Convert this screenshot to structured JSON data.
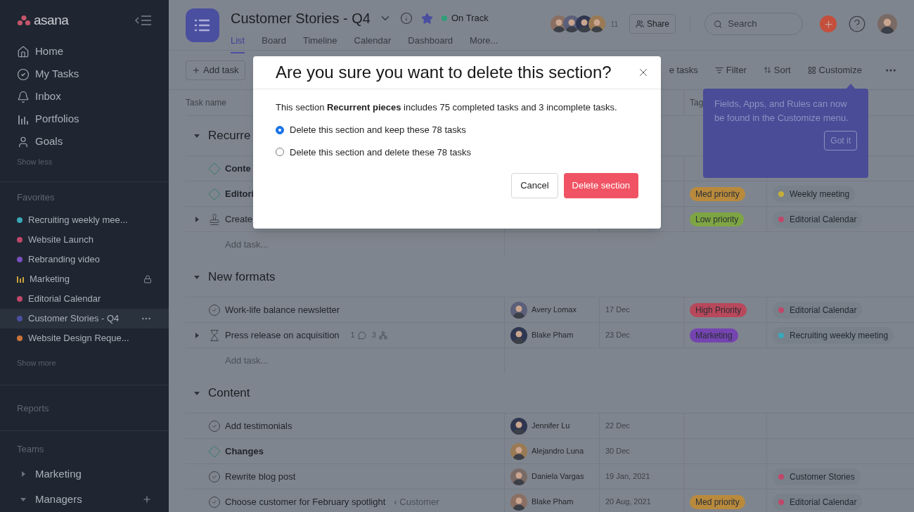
{
  "sidebar": {
    "logo": "asana",
    "nav": [
      {
        "label": "Home"
      },
      {
        "label": "My Tasks"
      },
      {
        "label": "Inbox"
      },
      {
        "label": "Portfolios"
      },
      {
        "label": "Goals"
      }
    ],
    "show_less": "Show less",
    "favorites_title": "Favorites",
    "favorites": [
      {
        "label": "Recruiting weekly mee...",
        "kind": "dot",
        "color": "#3aa8b8",
        "locked": false,
        "selected": false
      },
      {
        "label": "Website Launch",
        "kind": "dot",
        "color": "#c0476a",
        "locked": false,
        "selected": false
      },
      {
        "label": "Rebranding video",
        "kind": "dot",
        "color": "#7a4fc0",
        "locked": false,
        "selected": false
      },
      {
        "label": "Marketing",
        "kind": "chart",
        "color": "#c9a23a",
        "locked": true,
        "selected": false
      },
      {
        "label": "Editorial Calendar",
        "kind": "dot",
        "color": "#c0476a",
        "locked": false,
        "selected": false
      },
      {
        "label": "Customer Stories - Q4",
        "kind": "dot",
        "color": "#4b4fa0",
        "locked": false,
        "selected": true
      },
      {
        "label": "Website Design Reque...",
        "kind": "dot",
        "color": "#c9743a",
        "locked": false,
        "selected": false
      }
    ],
    "show_more": "Show more",
    "reports": "Reports",
    "teams_title": "Teams",
    "teams": [
      {
        "label": "Marketing",
        "expanded": false
      },
      {
        "label": "Managers",
        "expanded": true
      }
    ]
  },
  "header": {
    "title": "Customer Stories - Q4",
    "starred": true,
    "status": {
      "label": "On Track",
      "color": "#2f9e7a"
    },
    "tabs": [
      {
        "label": "List",
        "selected": true
      },
      {
        "label": "Board",
        "selected": false
      },
      {
        "label": "Timeline",
        "selected": false
      },
      {
        "label": "Calendar",
        "selected": false
      },
      {
        "label": "Dashboard",
        "selected": false
      },
      {
        "label": "More...",
        "selected": false
      }
    ],
    "member_count": "11",
    "share": "Share",
    "search": {
      "placeholder": "Search"
    }
  },
  "toolbar": {
    "add_task": "Add task",
    "actions": [
      {
        "label": "e tasks"
      },
      {
        "label": "Filter"
      },
      {
        "label": "Sort"
      },
      {
        "label": "Customize"
      }
    ]
  },
  "table": {
    "columns": [
      {
        "label": "Task name"
      },
      {
        "label": "Tag"
      }
    ],
    "sections": [
      {
        "title": "Recurre",
        "add_task": "Add task...",
        "tasks": [
          {
            "name": "Conte",
            "kind": "milestone",
            "expandable": false
          },
          {
            "name": "Editori",
            "kind": "milestone",
            "expandable": false,
            "priority": {
              "label": "Med priority",
              "color": "#b98a3c"
            },
            "project": {
              "label": "Weekly meeting",
              "color": "#c4ae3a"
            }
          },
          {
            "name": "Create",
            "kind": "approval",
            "expandable": true,
            "priority": {
              "label": "Low priority",
              "color": "#7ea543"
            },
            "project": {
              "label": "Editorial Calendar",
              "color": "#c0476a"
            }
          }
        ]
      },
      {
        "title": "New formats",
        "add_task": "Add task...",
        "tasks": [
          {
            "name": "Work-life balance newsletter",
            "kind": "task",
            "expandable": false,
            "assignee": "Avery Lomax",
            "due": "17 Dec",
            "priority": {
              "label": "High Priority",
              "color": "#b8485c"
            },
            "project": {
              "label": "Editorial Calendar",
              "color": "#c0476a"
            }
          },
          {
            "name": "Press release on acquisition",
            "kind": "waiting",
            "expandable": true,
            "comments": "1",
            "subtasks": "3",
            "assignee": "Blake Pham",
            "due": "23 Dec",
            "priority": {
              "label": "Marketing",
              "color": "#7444b0"
            },
            "project": {
              "label": "Recruiting weekly meeting",
              "color": "#3aa8b8"
            }
          }
        ]
      },
      {
        "title": "Content",
        "tasks": [
          {
            "name": "Add testimonials",
            "kind": "task",
            "expandable": false,
            "assignee": "Jennifer Lu",
            "due": "22 Dec"
          },
          {
            "name": "Changes",
            "kind": "milestone",
            "expandable": false,
            "assignee": "Alejandro Luna",
            "due": "30 Dec"
          },
          {
            "name": "Rewrite blog post",
            "kind": "task",
            "expandable": false,
            "assignee": "Daniela Vargas",
            "due": "19 Jan, 2021",
            "project": {
              "label": "Customer Stories",
              "color": "#c0476a"
            }
          },
          {
            "name": "Choose customer for February spotlight",
            "kind": "task",
            "expandable": false,
            "parent": "‹ Customer",
            "assignee": "Blake Pham",
            "due": "20 Aug, 2021",
            "priority": {
              "label": "Med priority",
              "color": "#b98a3c"
            },
            "project": {
              "label": "Editorial Calendar",
              "color": "#c0476a"
            }
          }
        ]
      }
    ]
  },
  "tooltip": {
    "text": "Fields, Apps, and Rules can now be found in the Customize menu.",
    "button": "Got it"
  },
  "dialog": {
    "title": "Are you sure you want to delete this section?",
    "body": "This section **Recurrent pieces** includes 75 completed tasks and 3 incomplete tasks.",
    "options": [
      {
        "label": "Delete this section and keep these 78 tasks",
        "selected": true
      },
      {
        "label": "Delete this section and delete these 78 tasks",
        "selected": false
      }
    ],
    "cancel": "Cancel",
    "confirm": "Delete section"
  }
}
